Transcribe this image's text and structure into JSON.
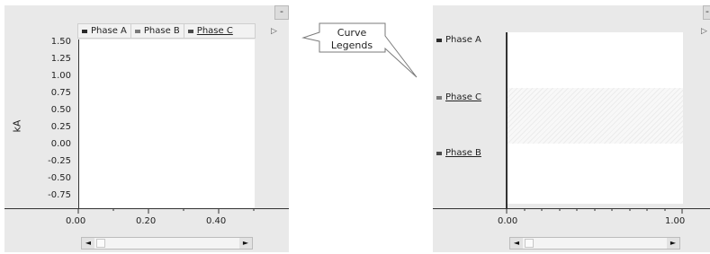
{
  "left_panel": {
    "legend": [
      {
        "label": "Phase A",
        "color": "#2b2b2b",
        "underlined": false
      },
      {
        "label": "Phase B",
        "color": "#7a7a7a",
        "underlined": false
      },
      {
        "label": "Phase C",
        "color": "#4a4a4a",
        "underlined": true
      }
    ],
    "y_axis_label": "kA",
    "y_ticks": [
      "1.50",
      "1.25",
      "1.00",
      "0.75",
      "0.50",
      "0.25",
      "0.00",
      "-0.25",
      "-0.50",
      "-0.75"
    ],
    "x_ticks": [
      "0.00",
      "0.20",
      "0.40"
    ],
    "minimize_label": "-",
    "expand_glyph": "▷",
    "scroll_left": "◄",
    "scroll_right": "►"
  },
  "callout": {
    "line1": "Curve",
    "line2": "Legends"
  },
  "right_panel": {
    "rows": [
      {
        "label": "Phase A",
        "underlined": false,
        "color": "#2b2b2b"
      },
      {
        "label": "Phase C",
        "underlined": true,
        "color": "#7a7a7a"
      },
      {
        "label": "Phase B",
        "underlined": true,
        "color": "#4a4a4a"
      }
    ],
    "x_ticks": [
      "0.00",
      "1.00"
    ],
    "minimize_label": "-",
    "expand_glyph": "▷",
    "scroll_left": "◄",
    "scroll_right": "►"
  }
}
